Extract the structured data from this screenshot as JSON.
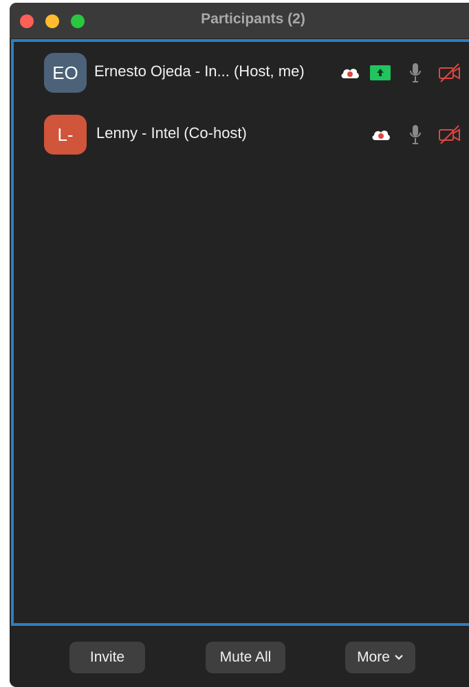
{
  "window": {
    "title": "Participants (2)"
  },
  "participants": [
    {
      "initials": "EO",
      "name": "Ernesto Ojeda - In... (Host, me)",
      "avatar_color": "#4c6278",
      "icons": [
        "cloud-recording-icon",
        "share-screen-icon",
        "mic-icon",
        "video-off-icon"
      ]
    },
    {
      "initials": "L-",
      "name": "Lenny - Intel (Co-host)",
      "avatar_color": "#d0553a",
      "icons": [
        "cloud-recording-icon",
        "mic-icon",
        "video-off-icon"
      ]
    }
  ],
  "toolbar": {
    "invite_label": "Invite",
    "mute_all_label": "Mute All",
    "more_label": "More"
  },
  "colors": {
    "panel_border": "#2d7fbf",
    "share_green": "#21c55d",
    "video_off_red": "#e0463f"
  }
}
